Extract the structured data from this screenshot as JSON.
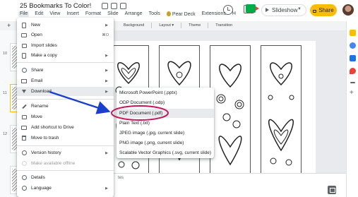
{
  "header": {
    "doc_title": "25 Bookmarks To Color!",
    "menus": [
      "File",
      "Edit",
      "View",
      "Insert",
      "Format",
      "Slide",
      "Arrange",
      "Tools",
      "Pear Deck",
      "Extensions",
      "H"
    ],
    "slideshow_label": "Slideshow",
    "share_label": "Share",
    "icons": [
      "history-icon",
      "comment-icon",
      "meet-icon",
      "lock-icon"
    ]
  },
  "toolbar": {
    "items": [
      "Background",
      "Layout ▾",
      "Theme",
      "Transition"
    ]
  },
  "filmstrip": {
    "slide_numbers": [
      "10",
      "11",
      "12"
    ]
  },
  "notes": {
    "label": "tes"
  },
  "file_menu": {
    "items": [
      {
        "label": "New",
        "icon": "doc-icon",
        "has_submenu": true
      },
      {
        "label": "Open",
        "icon": "folder-icon",
        "shortcut": "⌘O"
      },
      {
        "label": "Import slides",
        "icon": "import-icon"
      },
      {
        "label": "Make a copy",
        "icon": "copy-icon",
        "has_submenu": true
      },
      {
        "label": "Share",
        "icon": "person-icon",
        "has_submenu": true
      },
      {
        "label": "Email",
        "icon": "mail-icon",
        "has_submenu": true
      },
      {
        "label": "Download",
        "icon": "download-icon",
        "has_submenu": true,
        "highlighted": true
      },
      {
        "label": "Rename",
        "icon": "rename-icon"
      },
      {
        "label": "Move",
        "icon": "move-icon"
      },
      {
        "label": "Add shortcut to Drive",
        "icon": "drive-shortcut-icon"
      },
      {
        "label": "Move to trash",
        "icon": "trash-icon"
      },
      {
        "label": "Version history",
        "icon": "clock-icon",
        "has_submenu": true
      },
      {
        "label": "Make available offline",
        "icon": "offline-icon",
        "disabled": true
      },
      {
        "label": "Details",
        "icon": "info-icon"
      },
      {
        "label": "Language",
        "icon": "globe-icon",
        "has_submenu": true
      }
    ]
  },
  "download_menu": {
    "items": [
      {
        "label": "Microsoft PowerPoint (.pptx)"
      },
      {
        "label": "ODP Document (.odp)"
      },
      {
        "label": "PDF Document (.pdf)",
        "highlighted": true
      },
      {
        "label": "Plain Text (.txt)"
      },
      {
        "label": "JPEG image (.jpg, current slide)"
      },
      {
        "label": "PNG image (.png, current slide)"
      },
      {
        "label": "Scalable Vector Graphics (.svg, current slide)"
      }
    ]
  },
  "annotation": {
    "arrow_color": "#1a3fcf",
    "circle_color": "#c2185b"
  },
  "colors": {
    "share": "#fbbc04",
    "highlight": "#e8eaed"
  }
}
